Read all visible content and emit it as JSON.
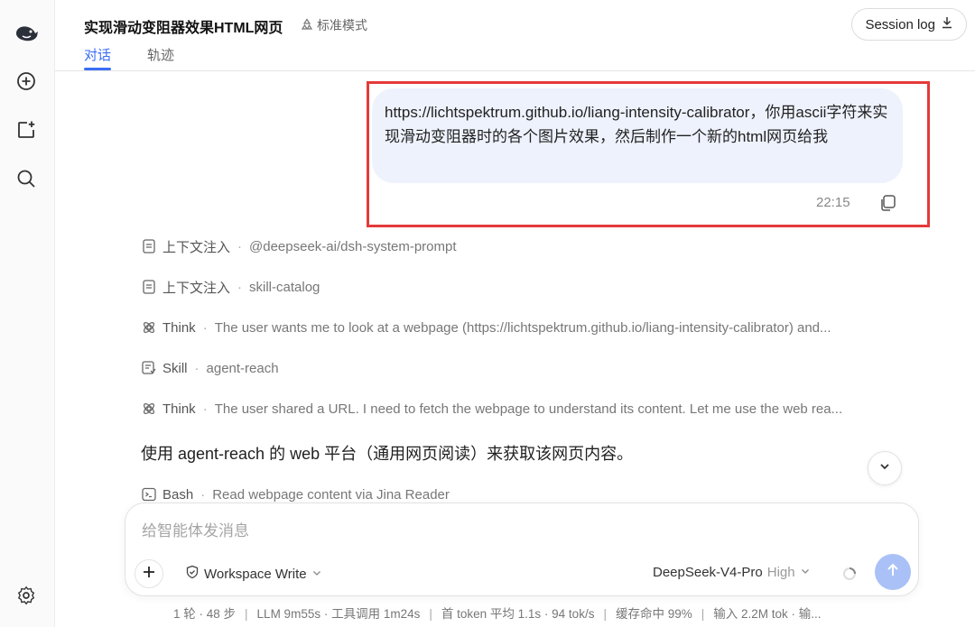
{
  "sidebar": {
    "icons": [
      "whale-logo-icon",
      "new-chat-icon",
      "add-window-icon",
      "search-icon",
      "settings-icon"
    ]
  },
  "header": {
    "title": "实现滑动变阻器效果HTML网页",
    "mode": "标准模式",
    "tabs": [
      {
        "label": "对话",
        "active": true
      },
      {
        "label": "轨迹",
        "active": false
      }
    ],
    "session_log": "Session log"
  },
  "chat": {
    "user_message": "https://lichtspektrum.github.io/liang-intensity-calibrator，你用ascii字符来实现滑动变阻器时的各个图片效果，然后制作一个新的html网页给我",
    "timestamp": "22:15",
    "steps": [
      {
        "icon": "document-icon",
        "label": "上下文注入",
        "detail": "@deepseek-ai/dsh-system-prompt"
      },
      {
        "icon": "document-icon",
        "label": "上下文注入",
        "detail": "skill-catalog"
      },
      {
        "icon": "think-icon",
        "label": "Think",
        "detail": "The user wants me to look at a webpage (https://lichtspektrum.github.io/liang-intensity-calibrator) and..."
      },
      {
        "icon": "skill-icon",
        "label": "Skill",
        "detail": "agent-reach"
      },
      {
        "icon": "think-icon",
        "label": "Think",
        "detail": "The user shared a URL. I need to fetch the webpage to understand its content. Let me use the web rea..."
      }
    ],
    "assistant_text": "使用 agent-reach 的 web 平台（通用网页阅读）来获取该网页内容。",
    "bash_step": {
      "icon": "terminal-icon",
      "label": "Bash",
      "detail": "Read webpage content via Jina Reader"
    }
  },
  "composer": {
    "placeholder": "给智能体发消息",
    "workspace": "Workspace Write",
    "model": "DeepSeek-V4-Pro",
    "level": "High"
  },
  "status": {
    "items": [
      "1 轮 · 48 步",
      "LLM 9m55s · 工具调用 1m24s",
      "首 token 平均 1.1s · 94 tok/s",
      "缓存命中 99%",
      "输入 2.2M tok · 输..."
    ]
  },
  "colors": {
    "accent": "#3b6ef5",
    "highlight_border": "#e53a3a",
    "bubble_bg": "#eef2fd",
    "send_button": "#a9c1f7"
  }
}
